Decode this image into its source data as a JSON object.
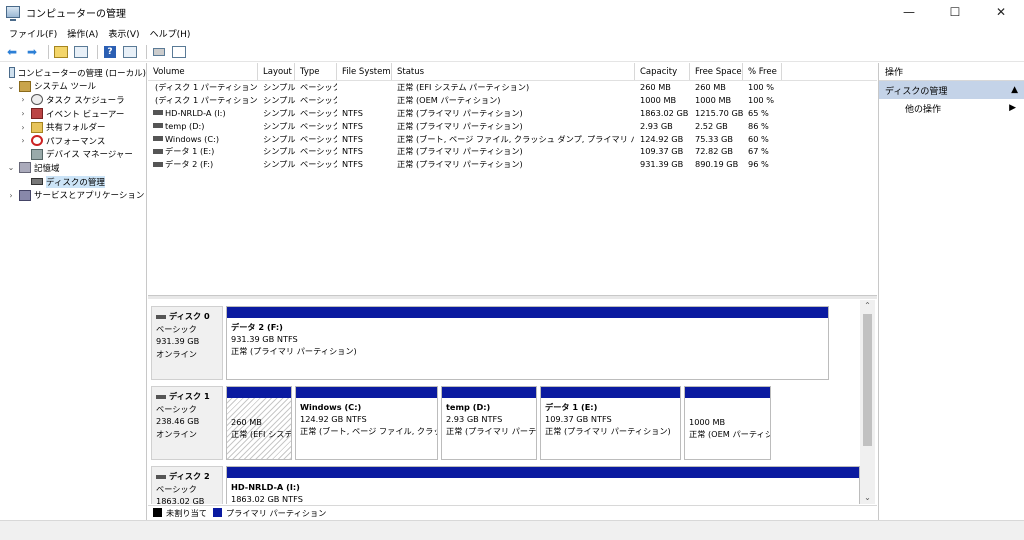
{
  "window": {
    "title": "コンピューターの管理",
    "minimize": "—",
    "maximize": "☐",
    "close": "✕"
  },
  "menu": [
    "ファイル(F)",
    "操作(A)",
    "表示(V)",
    "ヘルプ(H)"
  ],
  "tree": [
    {
      "label": "コンピューターの管理 (ローカル)",
      "level": 0,
      "expander": "",
      "icon": "computer-icon"
    },
    {
      "label": "システム ツール",
      "level": 1,
      "expander": "⌄",
      "icon": "tools-icon"
    },
    {
      "label": "タスク スケジューラ",
      "level": 2,
      "expander": "›",
      "icon": "clock-icon"
    },
    {
      "label": "イベント ビューアー",
      "level": 2,
      "expander": "›",
      "icon": "event-icon"
    },
    {
      "label": "共有フォルダー",
      "level": 2,
      "expander": "›",
      "icon": "folder-icon"
    },
    {
      "label": "パフォーマンス",
      "level": 2,
      "expander": "›",
      "icon": "performance-icon"
    },
    {
      "label": "デバイス マネージャー",
      "level": 2,
      "expander": "",
      "icon": "device-icon"
    },
    {
      "label": "記憶域",
      "level": 1,
      "expander": "⌄",
      "icon": "storage-icon"
    },
    {
      "label": "ディスクの管理",
      "level": 2,
      "expander": "",
      "icon": "disk-icon",
      "selected": true
    },
    {
      "label": "サービスとアプリケーション",
      "level": 1,
      "expander": "›",
      "icon": "services-icon"
    }
  ],
  "volumes": {
    "columns": [
      "Volume",
      "Layout",
      "Type",
      "File System",
      "Status",
      "Capacity",
      "Free Space",
      "% Free"
    ],
    "rows": [
      [
        "(ディスク 1 パーティション 1)",
        "シンプル",
        "ベーシック",
        "",
        "正常 (EFI システム パーティション)",
        "260 MB",
        "260 MB",
        "100 %"
      ],
      [
        "(ディスク 1 パーティション 6)",
        "シンプル",
        "ベーシック",
        "",
        "正常 (OEM パーティション)",
        "1000 MB",
        "1000 MB",
        "100 %"
      ],
      [
        "HD-NRLD-A (I:)",
        "シンプル",
        "ベーシック",
        "NTFS",
        "正常 (プライマリ パーティション)",
        "1863.02 GB",
        "1215.70 GB",
        "65 %"
      ],
      [
        "temp (D:)",
        "シンプル",
        "ベーシック",
        "NTFS",
        "正常 (プライマリ パーティション)",
        "2.93 GB",
        "2.52 GB",
        "86 %"
      ],
      [
        "Windows (C:)",
        "シンプル",
        "ベーシック",
        "NTFS",
        "正常 (ブート, ページ ファイル, クラッシュ ダンプ, プライマリ パーティション)",
        "124.92 GB",
        "75.33 GB",
        "60 %"
      ],
      [
        "データ 1 (E:)",
        "シンプル",
        "ベーシック",
        "NTFS",
        "正常 (プライマリ パーティション)",
        "109.37 GB",
        "72.82 GB",
        "67 %"
      ],
      [
        "データ 2 (F:)",
        "シンプル",
        "ベーシック",
        "NTFS",
        "正常 (プライマリ パーティション)",
        "931.39 GB",
        "890.19 GB",
        "96 %"
      ]
    ]
  },
  "disks": [
    {
      "name": "ディスク 0",
      "type": "ベーシック",
      "size": "931.39 GB",
      "state": "オンライン",
      "partitions": [
        {
          "name": "データ 2 (F:)",
          "size": "931.39 GB NTFS",
          "status": "正常 (プライマリ パーティション)"
        }
      ]
    },
    {
      "name": "ディスク 1",
      "type": "ベーシック",
      "size": "238.46 GB",
      "state": "オンライン",
      "partitions": [
        {
          "name": "",
          "size": "260 MB",
          "status": "正常 (EFI システ"
        },
        {
          "name": "Windows (C:)",
          "size": "124.92 GB NTFS",
          "status": "正常 (ブート, ページ ファイル, クラッシュ ダ"
        },
        {
          "name": "temp (D:)",
          "size": "2.93 GB NTFS",
          "status": "正常 (プライマリ パーティシ"
        },
        {
          "name": "データ 1 (E:)",
          "size": "109.37 GB NTFS",
          "status": "正常 (プライマリ パーティション)"
        },
        {
          "name": "",
          "size": "1000 MB",
          "status": "正常 (OEM パーティシ"
        }
      ]
    },
    {
      "name": "ディスク 2",
      "type": "ベーシック",
      "size": "1863.02 GB",
      "state": "",
      "partitions": [
        {
          "name": "HD-NRLD-A (I:)",
          "size": "1863.02 GB NTFS",
          "status": ""
        }
      ]
    }
  ],
  "legend": {
    "unallocated": "未割り当て",
    "primary": "プライマリ パーティション",
    "unallocated_color": "#000000",
    "primary_color": "#0a1aa0"
  },
  "actions": {
    "header": "操作",
    "section": "ディスクの管理",
    "section_arrow": "▲",
    "more": "他の操作",
    "more_arrow": "▶"
  },
  "scroll": {
    "up": "⌃",
    "down": "⌄"
  },
  "toolbar": {
    "back": "⬅",
    "forward": "➡"
  }
}
